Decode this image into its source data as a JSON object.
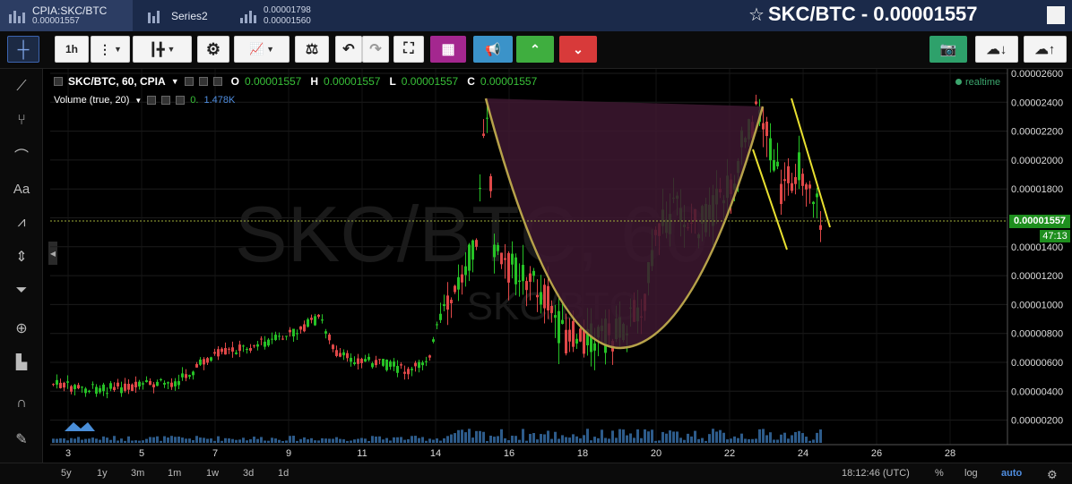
{
  "header": {
    "tabs": [
      {
        "label": "CPIA:SKC/BTC",
        "value": "0.00001557"
      },
      {
        "label": "Series2",
        "value": ""
      },
      {
        "label": "0.00001798",
        "value": "0.00001560"
      }
    ],
    "title_symbol": "SKC/BTC",
    "title_sep": "-",
    "title_price": "0.00001557"
  },
  "toolbar": {
    "interval_label": "1h"
  },
  "legend": {
    "symbol": "SKC/BTC, 60, CPIA",
    "o_label": "O",
    "o_value": "0.00001557",
    "h_label": "H",
    "h_value": "0.00001557",
    "l_label": "L",
    "l_value": "0.00001557",
    "c_label": "C",
    "c_value": "0.00001557",
    "volume_label": "Volume (true, 20)",
    "volume_zero": "0.",
    "volume_value": "1.478K",
    "realtime": "realtime"
  },
  "watermark": {
    "main": "SKC/BTC, 60",
    "sub": "SKC/BTC"
  },
  "price_axis": {
    "ticks": [
      "0.00002600",
      "0.00002400",
      "0.00002200",
      "0.00002000",
      "0.00001800",
      "0.00001600",
      "0.00001400",
      "0.00001200",
      "0.00001000",
      "0.00000800",
      "0.00000600",
      "0.00000400",
      "0.00000200"
    ],
    "current_price": "0.00001557",
    "countdown": "47:13"
  },
  "time_axis": {
    "ticks": [
      "3",
      "5",
      "7",
      "9",
      "11",
      "14",
      "16",
      "18",
      "20",
      "22",
      "24",
      "26",
      "28"
    ]
  },
  "bottom": {
    "ranges": [
      "5y",
      "1y",
      "3m",
      "1m",
      "1w",
      "3d",
      "1d"
    ],
    "clock": "18:12:46 (UTC)",
    "percent": "%",
    "log": "log",
    "auto": "auto"
  },
  "colors": {
    "up": "#26c226",
    "down": "#e04848",
    "volume": "#2d5b8a",
    "cup_fill": "#3d1830",
    "cup_line": "#b7a24a",
    "trend_line": "#e8e030",
    "price_line": "#9fae3a"
  }
}
